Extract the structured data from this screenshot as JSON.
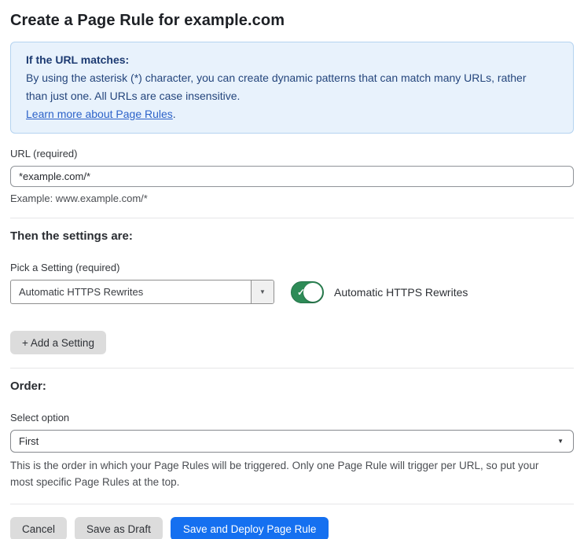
{
  "page": {
    "title": "Create a Page Rule for example.com"
  },
  "info_box": {
    "heading": "If the URL matches:",
    "body": "By using the asterisk (*) character, you can create dynamic patterns that can match many URLs, rather than just one. All URLs are case insensitive.",
    "link_label": "Learn more about Page Rules",
    "link_suffix": "."
  },
  "url_field": {
    "label": "URL (required)",
    "value": "*example.com/*",
    "hint": "Example: www.example.com/*"
  },
  "settings_section": {
    "heading": "Then the settings are:",
    "picker_label": "Pick a Setting (required)",
    "picker_value": "Automatic HTTPS Rewrites",
    "toggle_state": "on",
    "toggle_label": "Automatic HTTPS Rewrites",
    "add_setting_label": "+ Add a Setting"
  },
  "order_section": {
    "heading": "Order:",
    "select_label": "Select option",
    "select_value": "First",
    "help": "This is the order in which your Page Rules will be triggered. Only one Page Rule will trigger per URL, so put your most specific Page Rules at the top."
  },
  "footer": {
    "cancel_label": "Cancel",
    "save_draft_label": "Save as Draft",
    "save_deploy_label": "Save and Deploy Page Rule"
  },
  "icons": {
    "dropdown_arrow": "▼",
    "toggle_check": "✓"
  },
  "colors": {
    "accent_blue": "#1570f0",
    "info_bg": "#e8f2fc",
    "info_border": "#b5d3f0",
    "info_text": "#24457c",
    "link_blue": "#2c62c9",
    "toggle_green": "#2e8b57"
  }
}
